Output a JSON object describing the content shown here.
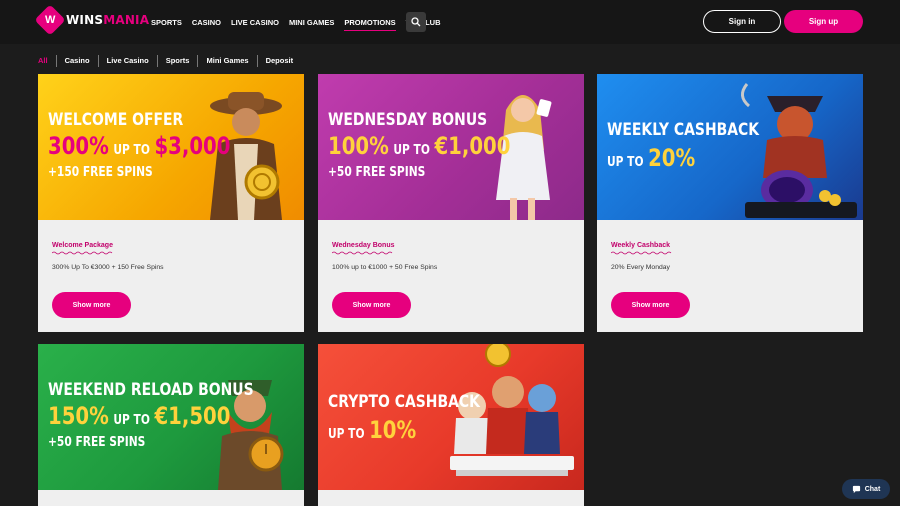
{
  "brand": {
    "name_a": "WINS",
    "name_b": "MANIA",
    "mark": "W",
    "accent": "#e6007e"
  },
  "nav": {
    "items": [
      {
        "label": "SPORTS"
      },
      {
        "label": "CASINO"
      },
      {
        "label": "LIVE CASINO"
      },
      {
        "label": "MINI GAMES"
      },
      {
        "label": "PROMOTIONS",
        "active": true
      },
      {
        "label": "VIP CLUB"
      }
    ],
    "search_icon": "search-icon"
  },
  "auth": {
    "signin": "Sign in",
    "signup": "Sign up"
  },
  "filters": [
    "All",
    "Casino",
    "Live Casino",
    "Sports",
    "Mini Games",
    "Deposit"
  ],
  "promos": [
    {
      "banner": {
        "title": "WELCOME OFFER",
        "pct": "300%",
        "upto": "UP TO",
        "amount": "$3,000",
        "extra": "+150 FREE SPINS",
        "bg": "#f7b500"
      },
      "tag": "Welcome Package",
      "desc": "300% Up To €3000 + 150 Free Spins",
      "button": "Show more"
    },
    {
      "banner": {
        "title": "WEDNESDAY BONUS",
        "pct": "100%",
        "upto": "UP TO",
        "amount": "€1,000",
        "extra": "+50 FREE SPINS",
        "bg": "#b0359d"
      },
      "tag": "Wednesday Bonus",
      "desc": "100% up to €1000 + 50 Free Spins",
      "button": "Show more"
    },
    {
      "banner": {
        "title": "WEEKLY CASHBACK",
        "upto": "UP TO",
        "pct": "20%",
        "bg": "#1c73d6"
      },
      "tag": "Weekly Cashback",
      "desc": "20% Every Monday",
      "button": "Show more"
    },
    {
      "banner": {
        "title": "WEEKEND RELOAD BONUS",
        "pct": "150%",
        "upto": "UP TO",
        "amount": "€1,500",
        "extra": "+50 FREE SPINS",
        "bg": "#1e9a3e"
      }
    },
    {
      "banner": {
        "title": "CRYPTO CASHBACK",
        "upto": "UP TO",
        "pct": "10%",
        "bg": "#e83a2a"
      }
    }
  ],
  "chat": {
    "label": "Chat"
  }
}
